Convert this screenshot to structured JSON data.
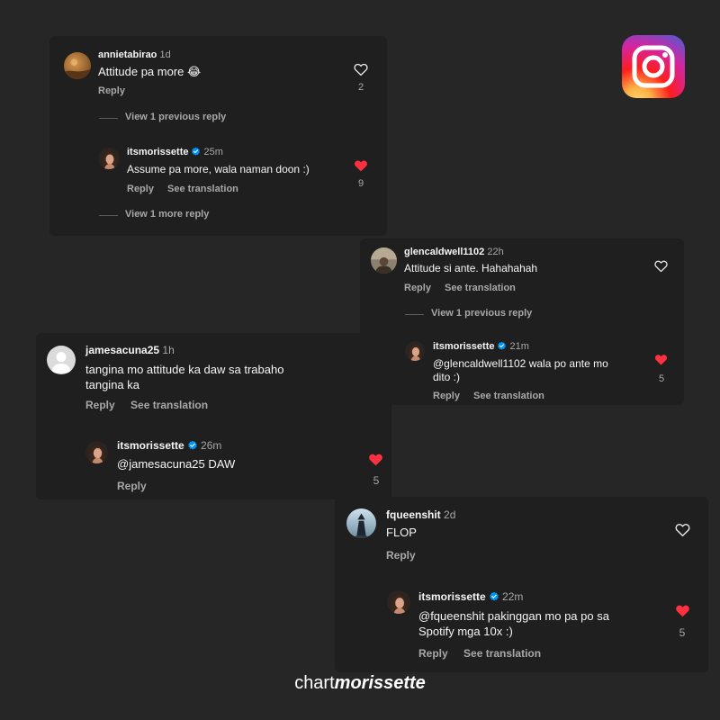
{
  "colors": {
    "background": "#262626",
    "card": "#1f1f1f",
    "liked": "#ff3040",
    "verified": "#0095f6",
    "muted": "#a8a8a8"
  },
  "icons": {
    "like": "heart-outline-icon",
    "liked": "heart-filled-icon",
    "verified": "verified-badge-icon",
    "logo": "instagram-logo"
  },
  "threads": [
    {
      "comment": {
        "username": "annietabirao",
        "time": "1d",
        "text": "Attitude pa more 😂",
        "reply": "Reply",
        "likes": "2"
      },
      "view_previous": "View 1 previous reply",
      "reply": {
        "username": "itsmorissette",
        "time": "25m",
        "text": "Assume pa more, wala naman doon :)",
        "reply": "Reply",
        "translate": "See translation",
        "likes": "9"
      },
      "view_more": "View 1 more reply"
    },
    {
      "comment": {
        "username": "glencaldwell1102",
        "time": "22h",
        "text": "Attitude si ante. Hahahahah",
        "reply": "Reply",
        "translate": "See translation"
      },
      "view_previous": "View 1 previous reply",
      "reply": {
        "username": "itsmorissette",
        "time": "21m",
        "text_line1": "@glencaldwell1102 wala po ante mo",
        "text_line2": "dito :)",
        "reply": "Reply",
        "translate": "See translation",
        "likes": "5"
      }
    },
    {
      "comment": {
        "username": "jamesacuna25",
        "time": "1h",
        "text_line1": "tangina mo attitude ka daw sa trabaho",
        "text_line2": "tangina ka",
        "reply": "Reply",
        "translate": "See translation"
      },
      "reply": {
        "username": "itsmorissette",
        "time": "26m",
        "text": "@jamesacuna25 DAW",
        "reply": "Reply",
        "likes": "5"
      }
    },
    {
      "comment": {
        "username": "fqueenshit",
        "time": "2d",
        "text": "FLOP",
        "reply": "Reply"
      },
      "reply": {
        "username": "itsmorissette",
        "time": "22m",
        "text_line1": "@fqueenshit pakinggan mo pa po sa",
        "text_line2": "Spotify mga 10x :)",
        "reply": "Reply",
        "translate": "See translation",
        "likes": "5"
      }
    }
  ],
  "footer": {
    "prefix": "chart",
    "brand": "morissette"
  }
}
